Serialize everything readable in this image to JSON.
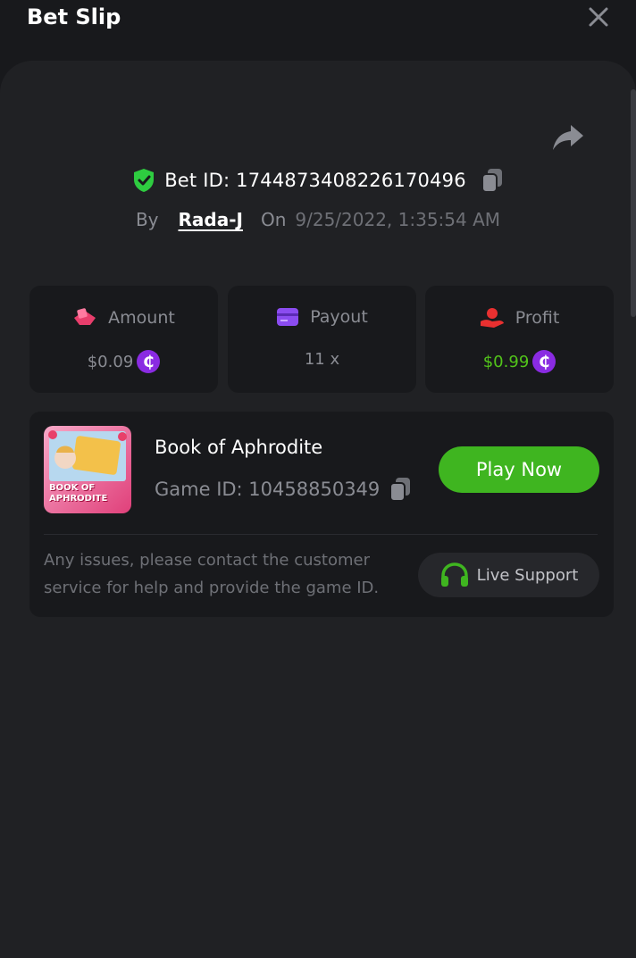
{
  "header": {
    "title": "Bet Slip"
  },
  "bet": {
    "id_text": "Bet ID: 1744873408226170496",
    "by_label": "By",
    "user": "Rada-J",
    "on_label": "On",
    "date": "9/25/2022, 1:35:54 AM"
  },
  "stats": {
    "amount": {
      "label": "Amount",
      "value": "$0.09"
    },
    "payout": {
      "label": "Payout",
      "value": "11 x"
    },
    "profit": {
      "label": "Profit",
      "value": "$0.99"
    }
  },
  "coin_symbol": "₵",
  "game": {
    "name": "Book of Aphrodite",
    "id_text": "Game ID: 10458850349",
    "thumb_text": "BOOK OF APHRODITE",
    "play_label": "Play Now",
    "issue_text": "Any issues, please contact the customer service for help and provide the game ID.",
    "support_label": "Live Support"
  },
  "colors": {
    "background": "#18191c",
    "panel": "#202124",
    "play_green": "#3fb520",
    "profit_green": "#52c41a",
    "coin_purple": "#8a2be2",
    "shield_green": "#2ecc40"
  },
  "icons": [
    "close-icon",
    "share-icon",
    "shield-check-icon",
    "copy-icon",
    "amount-icon",
    "payout-icon",
    "profit-icon",
    "coin-icon",
    "headset-icon"
  ]
}
